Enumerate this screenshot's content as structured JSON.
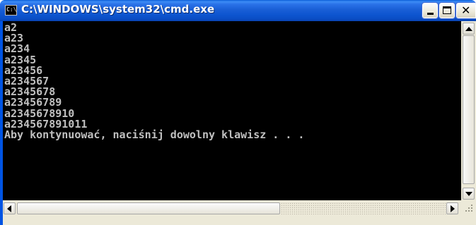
{
  "window": {
    "title": "C:\\WINDOWS\\system32\\cmd.exe",
    "icon_label": "C:\\",
    "icon": "cmd-icon"
  },
  "controls": {
    "minimize_icon": "minimize-icon",
    "maximize_icon": "maximize-icon",
    "close_icon": "close-icon",
    "close_glyph": "✕"
  },
  "console": {
    "lines": [
      "a2",
      "a23",
      "a234",
      "a2345",
      "a23456",
      "a234567",
      "a2345678",
      "a23456789",
      "a2345678910",
      "a234567891011",
      "Aby kontynuować, naciśnij dowolny klawisz . . ."
    ],
    "background": "#000000",
    "foreground": "#c0c0c0"
  },
  "colors": {
    "titlebar": "#0a4dc4",
    "frame": "#0054e3",
    "scrollbar": "#ece9d8"
  }
}
